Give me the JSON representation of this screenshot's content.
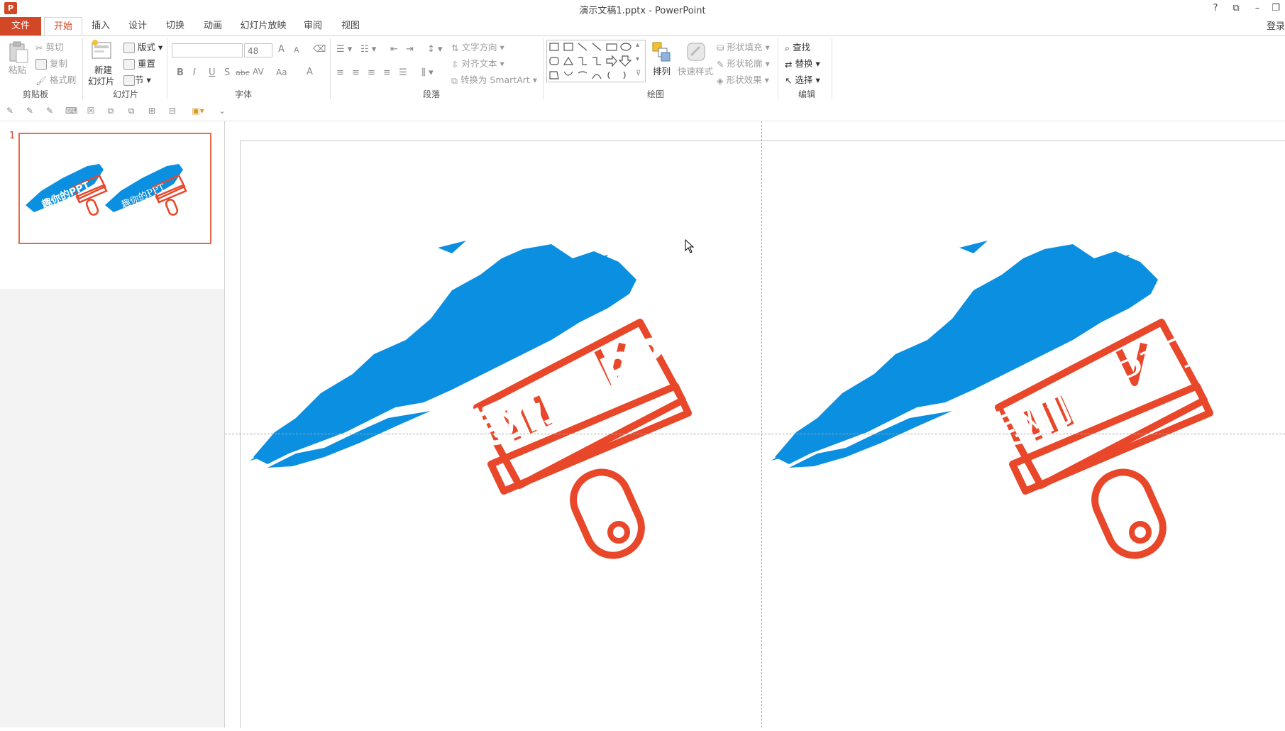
{
  "window": {
    "title": "演示文稿1.pptx - PowerPoint",
    "app_icon": "P",
    "help": "?",
    "ribbon_display": "⧉",
    "minimize": "–",
    "restore": "❐"
  },
  "tabs": [
    "文件",
    "开始",
    "插入",
    "设计",
    "切换",
    "动画",
    "幻灯片放映",
    "审阅",
    "视图"
  ],
  "login": "登录",
  "ribbon": {
    "clipboard": {
      "label": "剪贴板",
      "paste": "粘贴",
      "cut": "剪切",
      "copy": "复制",
      "format_painter": "格式刷"
    },
    "slides": {
      "label": "幻灯片",
      "new_slide_1": "新建",
      "new_slide_2": "幻灯片",
      "layout": "版式",
      "reset": "重置",
      "section": "节"
    },
    "font": {
      "label": "字体",
      "font_name": "",
      "font_size": "48",
      "bold": "B",
      "italic": "I",
      "underline": "U",
      "shadow": "S",
      "strike": "abc",
      "spacing": "AV",
      "case": "Aa",
      "color": "A",
      "grow": "A",
      "shrink": "A"
    },
    "paragraph": {
      "label": "段落",
      "text_direction": "文字方向",
      "align_text": "对齐文本",
      "smartart": "转换为 SmartArt"
    },
    "drawing": {
      "label": "绘图",
      "arrange": "排列",
      "quick_styles": "快速样式",
      "shape_fill": "形状填充",
      "shape_outline": "形状轮廓",
      "shape_effects": "形状效果"
    },
    "editing": {
      "label": "编辑",
      "find": "查找",
      "replace": "替换",
      "select": "选择"
    }
  },
  "thumbnail": {
    "number": "1"
  },
  "slide": {
    "left_text": "趣你的PPT",
    "right_text": "趣你的PPT"
  },
  "colors": {
    "accent": "#d24726",
    "brush_blue": "#0b8fe0",
    "brush_red": "#e8472a"
  }
}
